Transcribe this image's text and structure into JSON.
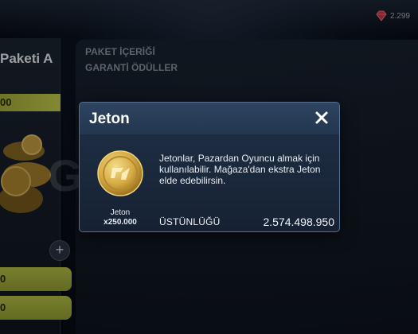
{
  "topbar": {
    "gem_count": "2.299"
  },
  "left_panel": {
    "pack_title": "Paketi A",
    "price": "00",
    "buy1_label": "0",
    "buy2_label": "0"
  },
  "content": {
    "heading1": "PAKET İÇERİĞİ",
    "heading2": "GARANTİ ÖDÜLLER"
  },
  "dialog": {
    "title": "Jeton",
    "coin_label": "Jeton",
    "coin_qty": "x250.000",
    "description": "Jetonlar, Pazardan Oyuncu almak için kullanılabilir. Mağaza'dan ekstra Jeton elde edebilirsin.",
    "stat_label": "ÜSTÜNLÜĞÜ",
    "stat_value": "2.574.498.950"
  },
  "watermark": "GameSatis",
  "colors": {
    "accent_green": "#b9c44a",
    "dialog_bg": "#1b2a3e",
    "gem": "#d8374a",
    "coin_gold": "#d9b24a"
  },
  "icons": {
    "gem": "gem-icon",
    "close": "close-icon",
    "plus": "plus-icon",
    "coin": "coin-icon"
  }
}
